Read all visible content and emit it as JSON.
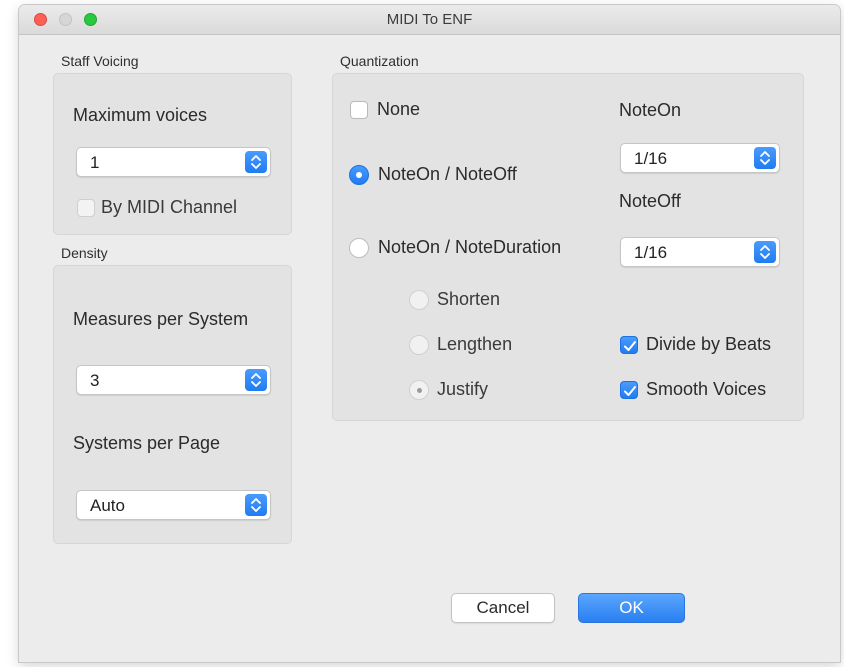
{
  "window": {
    "title": "MIDI To ENF"
  },
  "staff_voicing": {
    "group_label": "Staff Voicing",
    "maximum_voices_label": "Maximum voices",
    "maximum_voices_value": "1",
    "by_midi_channel_label": "By MIDI Channel",
    "by_midi_channel_checked": false
  },
  "density": {
    "group_label": "Density",
    "measures_per_system_label": "Measures per System",
    "measures_per_system_value": "3",
    "systems_per_page_label": "Systems per Page",
    "systems_per_page_value": "Auto"
  },
  "quantization": {
    "group_label": "Quantization",
    "none_label": "None",
    "none_checked": false,
    "noteon_noteoff_label": "NoteOn / NoteOff",
    "noteon_noteduration_label": "NoteOn / NoteDuration",
    "selected_mode": "NoteOn / NoteOff",
    "shorten_label": "Shorten",
    "lengthen_label": "Lengthen",
    "justify_label": "Justify",
    "duration_option_selected": "Justify",
    "noteon_label": "NoteOn",
    "noteon_value": "1/16",
    "noteoff_label": "NoteOff",
    "noteoff_value": "1/16",
    "divide_by_beats_label": "Divide by Beats",
    "divide_by_beats_checked": true,
    "smooth_voices_label": "Smooth Voices",
    "smooth_voices_checked": true
  },
  "buttons": {
    "cancel_label": "Cancel",
    "ok_label": "OK"
  },
  "colors": {
    "accent": "#2a7ff0",
    "close": "#fe5f57",
    "zoom": "#28c840"
  }
}
